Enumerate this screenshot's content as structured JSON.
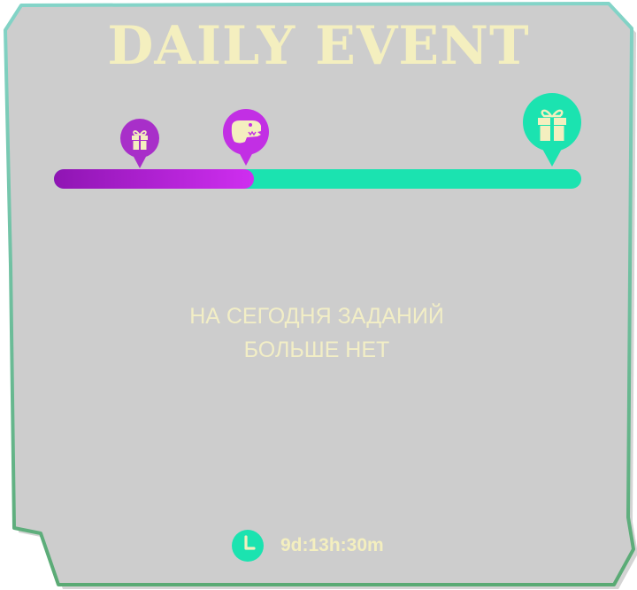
{
  "title": "DAILY EVENT",
  "progress": {
    "fraction": 0.38,
    "rewards": [
      {
        "icon": "gift-icon",
        "state": "claimed",
        "color": "#a82fc9"
      },
      {
        "icon": "dino-head-icon",
        "state": "current",
        "color": "#c22fe4"
      },
      {
        "icon": "gift-icon",
        "state": "locked",
        "color": "#1be3b0"
      }
    ],
    "filled_color": "#c227e6",
    "empty_color": "#1be3b0"
  },
  "message": {
    "line1": "НА СЕГОДНЯ ЗАДАНИЙ",
    "line2": "БОЛЬШЕ НЕТ"
  },
  "timer": {
    "icon": "clock-icon",
    "value": "9d:13h:30m"
  },
  "colors": {
    "panel_fill": "#cdcdcd",
    "panel_border_top": "#7fd1c4",
    "panel_border_bottom": "#5faf78",
    "text_cream": "#f4efbf"
  }
}
